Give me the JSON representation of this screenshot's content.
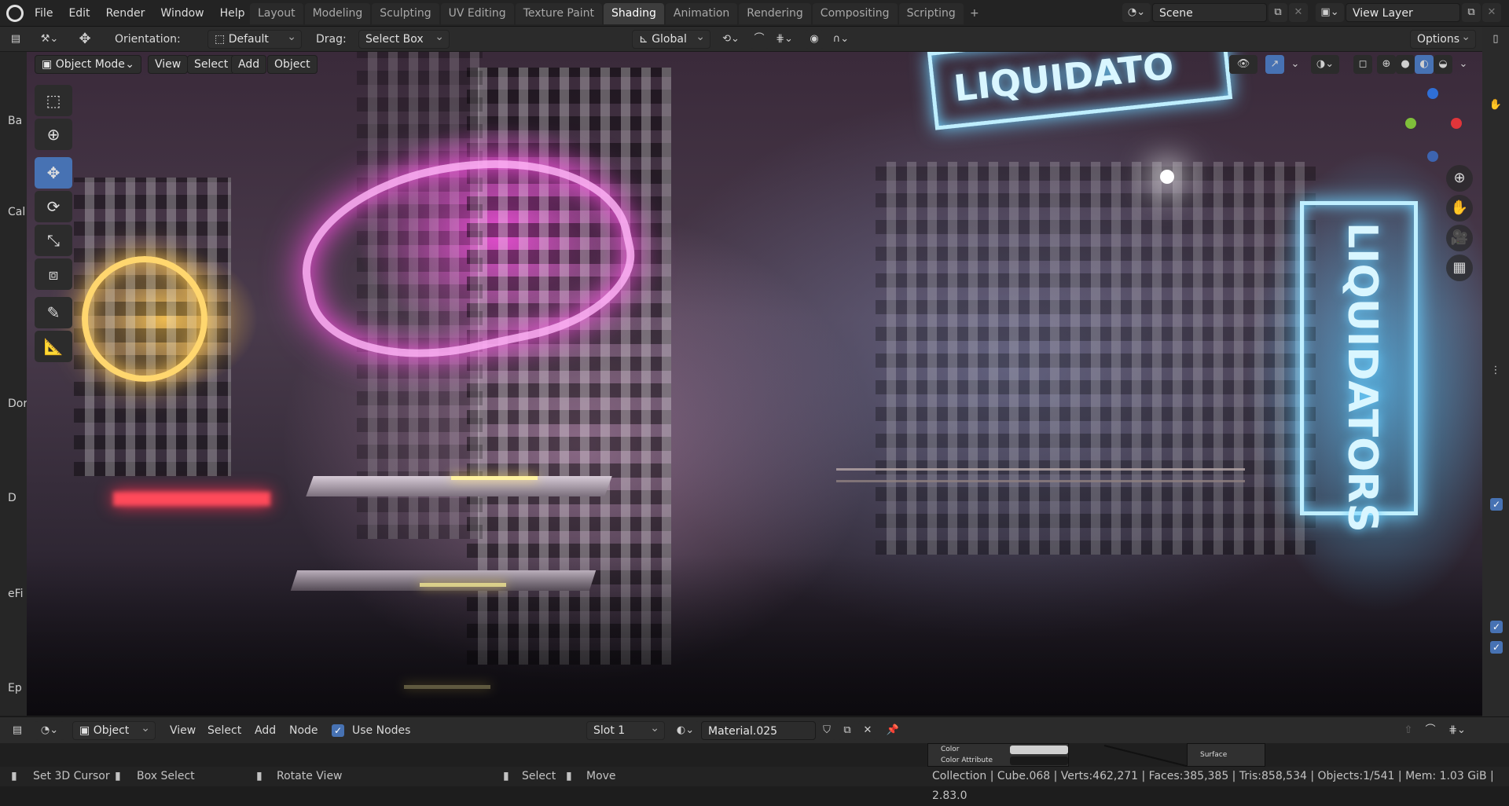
{
  "menu": [
    "File",
    "Edit",
    "Render",
    "Window",
    "Help"
  ],
  "workspace_tabs": [
    {
      "label": "Layout",
      "active": false
    },
    {
      "label": "Modeling",
      "active": false
    },
    {
      "label": "Sculpting",
      "active": false
    },
    {
      "label": "UV Editing",
      "active": false
    },
    {
      "label": "Texture Paint",
      "active": false
    },
    {
      "label": "Shading",
      "active": true
    },
    {
      "label": "Animation",
      "active": false
    },
    {
      "label": "Rendering",
      "active": false
    },
    {
      "label": "Compositing",
      "active": false
    },
    {
      "label": "Scripting",
      "active": false
    }
  ],
  "scene": {
    "name": "Scene",
    "view_layer": "View Layer"
  },
  "tool_header": {
    "orientation_label": "Orientation:",
    "orientation_value": "Default",
    "drag_label": "Drag:",
    "drag_value": "Select Box",
    "transform_orientation": "Global",
    "options_label": "Options"
  },
  "viewport_header": {
    "mode": "Object Mode",
    "menus": [
      "View",
      "Select",
      "Add",
      "Object"
    ]
  },
  "viewport_signs": {
    "sign_top": "LIQUIDATO",
    "sign_right": "LIQUIDATORS"
  },
  "left_strip_labels": [
    "Ba",
    "Cal",
    "Dor",
    "D",
    "eFi",
    "Ep"
  ],
  "node_header": {
    "object_label": "Object",
    "menus": [
      "View",
      "Select",
      "Add",
      "Node"
    ],
    "use_nodes_label": "Use Nodes",
    "slot": "Slot 1",
    "material": "Material.025"
  },
  "node_area": {
    "color_label": "Color",
    "color_attribute_label": "Color Attribute",
    "surface_label": "Surface"
  },
  "status_bar": {
    "hints": [
      "Set 3D Cursor",
      "Box Select",
      "Rotate View",
      "Select",
      "Move"
    ],
    "stats": "Collection | Cube.068 | Verts:462,271 | Faces:385,385 | Tris:858,534 | Objects:1/541 | Mem: 1.03 GiB | 2.83.0"
  },
  "colors": {
    "accent": "#4772b3",
    "neon_pink": "#ff50e6",
    "neon_blue": "#6fd2ff",
    "neon_yellow": "#ffc850"
  }
}
